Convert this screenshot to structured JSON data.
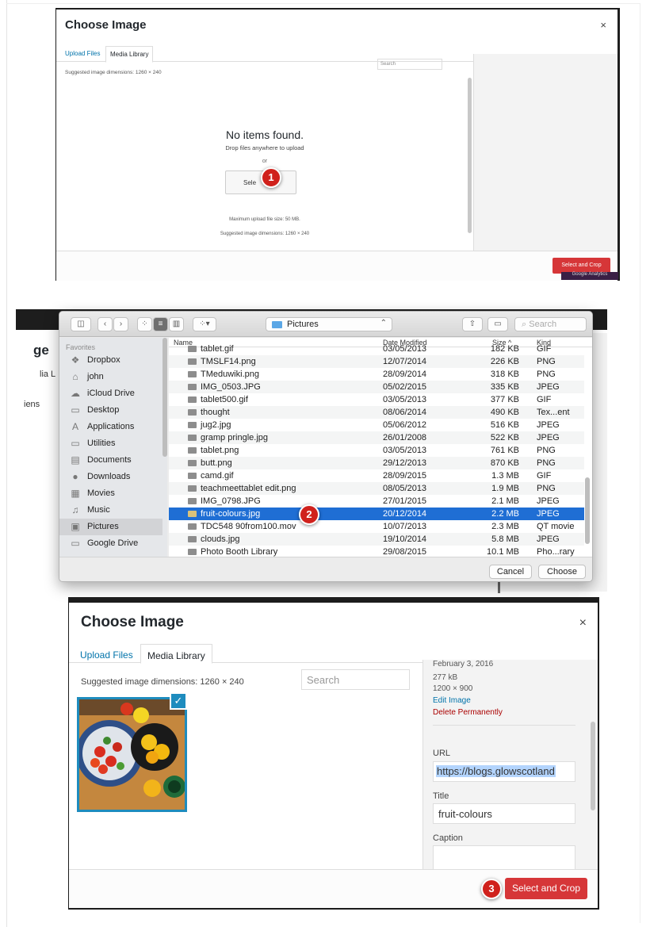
{
  "step1": {
    "title": "Choose Image",
    "close": "×",
    "tabs": [
      "Upload Files",
      "Media Library"
    ],
    "suggested": "Suggested image dimensions: 1260 × 240",
    "search_placeholder": "Search",
    "no_items": "No items found.",
    "drop": "Drop files anywhere to upload",
    "or": "or",
    "select_btn": "Sele",
    "max_size": "Maximum upload file size: 50 MB.",
    "dims": "Suggested image dimensions: 1260 × 240",
    "crop_btn": "Select and Crop",
    "tooltip": "Google Analytics",
    "marker": "1"
  },
  "step2": {
    "location": "Pictures",
    "search_placeholder": "Search",
    "side_heading": "Favorites",
    "background": {
      "ge": "ge",
      "lia": "lia L",
      "iens": "iens"
    },
    "sidebar": [
      {
        "icon": "dropbox-icon",
        "glyph": "❖",
        "label": "Dropbox"
      },
      {
        "icon": "home-icon",
        "glyph": "⌂",
        "label": "john"
      },
      {
        "icon": "cloud-icon",
        "glyph": "☁",
        "label": "iCloud Drive"
      },
      {
        "icon": "desktop-icon",
        "glyph": "▭",
        "label": "Desktop"
      },
      {
        "icon": "applications-icon",
        "glyph": "A",
        "label": "Applications"
      },
      {
        "icon": "folder-icon",
        "glyph": "▭",
        "label": "Utilities"
      },
      {
        "icon": "documents-icon",
        "glyph": "▤",
        "label": "Documents"
      },
      {
        "icon": "downloads-icon",
        "glyph": "●",
        "label": "Downloads"
      },
      {
        "icon": "movies-icon",
        "glyph": "▦",
        "label": "Movies"
      },
      {
        "icon": "music-icon",
        "glyph": "♫",
        "label": "Music"
      },
      {
        "icon": "pictures-icon",
        "glyph": "▣",
        "label": "Pictures"
      },
      {
        "icon": "folder-icon",
        "glyph": "▭",
        "label": "Google Drive"
      }
    ],
    "columns": {
      "name": "Name",
      "date": "Date Modified",
      "size": "Size",
      "kind": "Kind"
    },
    "files": [
      {
        "name": "tablet.gif",
        "date": "03/05/2013",
        "size": "182 KB",
        "kind": "GIF"
      },
      {
        "name": "TMSLF14.png",
        "date": "12/07/2014",
        "size": "226 KB",
        "kind": "PNG"
      },
      {
        "name": "TMeduwiki.png",
        "date": "28/09/2014",
        "size": "318 KB",
        "kind": "PNG"
      },
      {
        "name": "IMG_0503.JPG",
        "date": "05/02/2015",
        "size": "335 KB",
        "kind": "JPEG"
      },
      {
        "name": "tablet500.gif",
        "date": "03/05/2013",
        "size": "377 KB",
        "kind": "GIF"
      },
      {
        "name": "thought",
        "date": "08/06/2014",
        "size": "490 KB",
        "kind": "Tex...ent"
      },
      {
        "name": "jug2.jpg",
        "date": "05/06/2012",
        "size": "516 KB",
        "kind": "JPEG"
      },
      {
        "name": "gramp pringle.jpg",
        "date": "26/01/2008",
        "size": "522 KB",
        "kind": "JPEG"
      },
      {
        "name": "tablet.png",
        "date": "03/05/2013",
        "size": "761 KB",
        "kind": "PNG"
      },
      {
        "name": "butt.png",
        "date": "29/12/2013",
        "size": "870 KB",
        "kind": "PNG"
      },
      {
        "name": "camd.gif",
        "date": "28/09/2015",
        "size": "1.3 MB",
        "kind": "GIF"
      },
      {
        "name": "teachmeettablet edit.png",
        "date": "08/05/2013",
        "size": "1.9 MB",
        "kind": "PNG"
      },
      {
        "name": "IMG_0798.JPG",
        "date": "27/01/2015",
        "size": "2.1 MB",
        "kind": "JPEG"
      },
      {
        "name": "fruit-colours.jpg",
        "date": "20/12/2014",
        "size": "2.2 MB",
        "kind": "JPEG",
        "selected": true
      },
      {
        "name": "TDC548 90from100.mov",
        "date": "10/07/2013",
        "size": "2.3 MB",
        "kind": "QT movie"
      },
      {
        "name": "clouds.jpg",
        "date": "19/10/2014",
        "size": "5.8 MB",
        "kind": "JPEG"
      },
      {
        "name": "Photo Booth Library",
        "date": "29/08/2015",
        "size": "10.1 MB",
        "kind": "Pho...rary"
      }
    ],
    "cancel": "Cancel",
    "choose": "Choose",
    "marker": "2"
  },
  "step3": {
    "title": "Choose Image",
    "close": "×",
    "tabs": [
      "Upload Files",
      "Media Library"
    ],
    "suggested": "Suggested image dimensions: 1260 × 240",
    "search_placeholder": "Search",
    "details": {
      "date": "February 3, 2016",
      "size": "277 kB",
      "dims": "1200 × 900",
      "edit": "Edit Image",
      "delete": "Delete Permanently"
    },
    "url_label": "URL",
    "url_value": "https://blogs.glowscotland",
    "title_label": "Title",
    "title_value": "fruit-colours",
    "caption_label": "Caption",
    "crop_btn": "Select and Crop",
    "marker": "3"
  }
}
